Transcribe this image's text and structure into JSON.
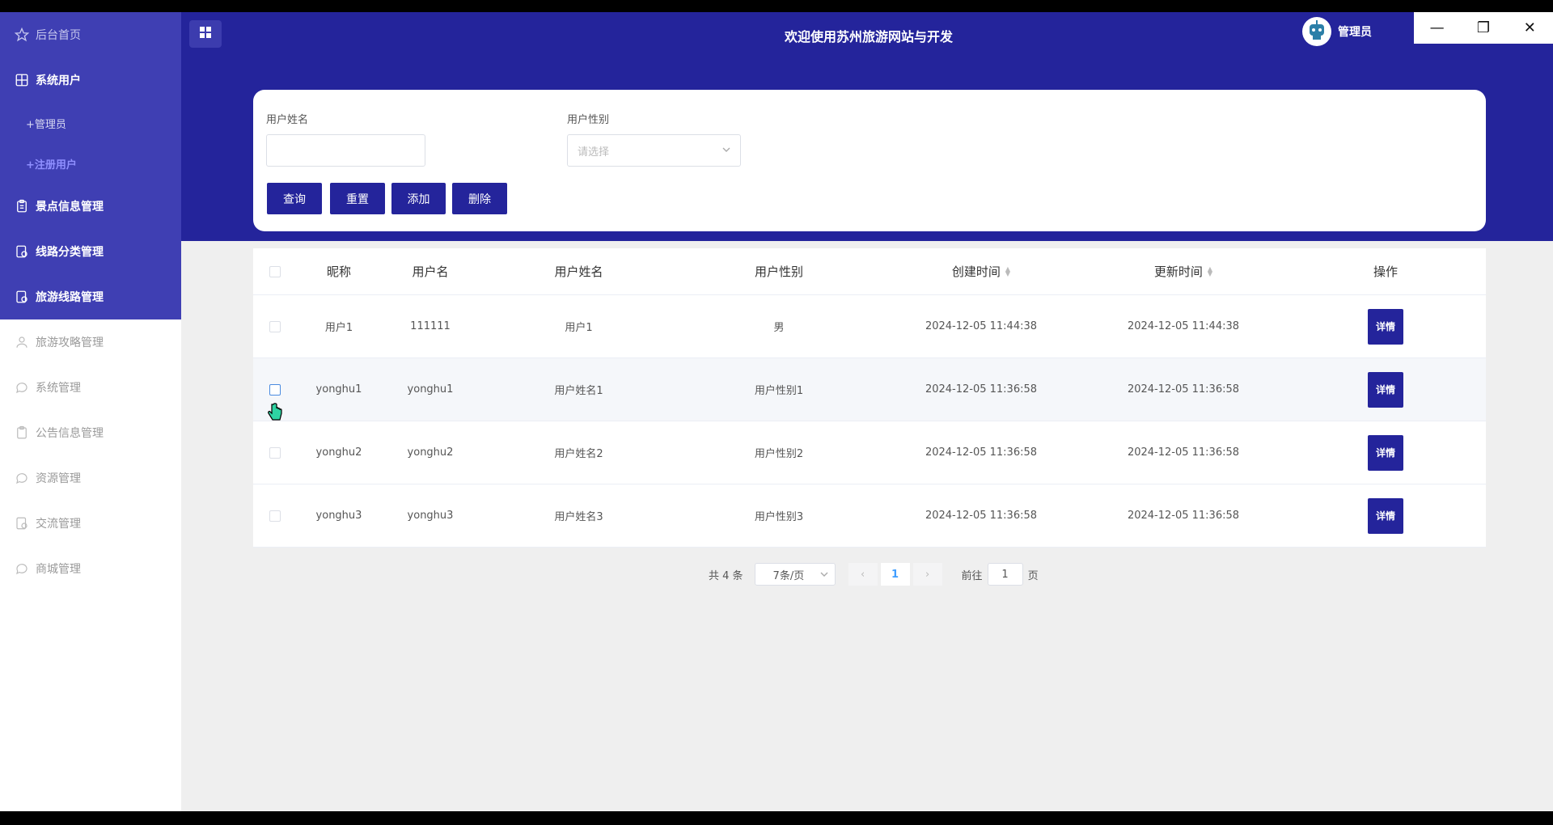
{
  "window_controls": {
    "minimize": "—",
    "restore": "❐",
    "close": "✕"
  },
  "sidebar": {
    "items": [
      {
        "label": "后台首页",
        "icon": "star-icon"
      },
      {
        "label": "系统用户",
        "icon": "grid-icon"
      },
      {
        "label": "+管理员"
      },
      {
        "label": "+注册用户"
      },
      {
        "label": "景点信息管理",
        "icon": "clipboard-icon"
      },
      {
        "label": "线路分类管理",
        "icon": "document-icon"
      },
      {
        "label": "旅游线路管理",
        "icon": "document-icon"
      },
      {
        "label": "旅游攻略管理",
        "icon": "user-icon"
      },
      {
        "label": "系统管理",
        "icon": "chat-icon"
      },
      {
        "label": "公告信息管理",
        "icon": "clipboard-icon"
      },
      {
        "label": "资源管理",
        "icon": "chat-icon"
      },
      {
        "label": "交流管理",
        "icon": "document-icon"
      },
      {
        "label": "商城管理",
        "icon": "chat-icon"
      }
    ]
  },
  "header": {
    "title": "欢迎使用苏州旅游网站与开发",
    "user": "管理员"
  },
  "search": {
    "name_label": "用户姓名",
    "name_value": "",
    "gender_label": "用户性别",
    "gender_placeholder": "请选择",
    "buttons": {
      "query": "查询",
      "reset": "重置",
      "add": "添加",
      "delete": "删除"
    }
  },
  "table": {
    "columns": [
      "昵称",
      "用户名",
      "用户姓名",
      "用户性别",
      "创建时间",
      "更新时间",
      "操作"
    ],
    "rows": [
      {
        "nickname": "用户1",
        "username": "111111",
        "realname": "用户1",
        "gender": "男",
        "created": "2024-12-05 11:44:38",
        "updated": "2024-12-05 11:44:38",
        "action": "详情"
      },
      {
        "nickname": "yonghu1",
        "username": "yonghu1",
        "realname": "用户姓名1",
        "gender": "用户性别1",
        "created": "2024-12-05 11:36:58",
        "updated": "2024-12-05 11:36:58",
        "action": "详情"
      },
      {
        "nickname": "yonghu2",
        "username": "yonghu2",
        "realname": "用户姓名2",
        "gender": "用户性别2",
        "created": "2024-12-05 11:36:58",
        "updated": "2024-12-05 11:36:58",
        "action": "详情"
      },
      {
        "nickname": "yonghu3",
        "username": "yonghu3",
        "realname": "用户姓名3",
        "gender": "用户性别3",
        "created": "2024-12-05 11:36:58",
        "updated": "2024-12-05 11:36:58",
        "action": "详情"
      }
    ]
  },
  "pagination": {
    "total": "共 4 条",
    "page_size": "7条/页",
    "prev": "‹",
    "current": "1",
    "next": "›",
    "goto_prefix": "前往",
    "goto_value": "1",
    "goto_suffix": "页"
  },
  "colors": {
    "primary": "#24249b",
    "sidebar_top": "#3f3fb3",
    "background": "#efefef"
  }
}
